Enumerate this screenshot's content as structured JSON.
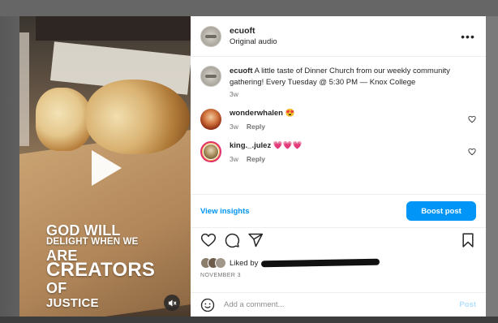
{
  "colors": {
    "accent": "#0095f6",
    "heart_red": "#ed4956",
    "text": "#262626",
    "muted": "#737373"
  },
  "media": {
    "overlay_lines": [
      "GOD WILL",
      "DELIGHT WHEN WE",
      "ARE",
      "CREATORS",
      "OF",
      "JUSTICE"
    ],
    "play_icon": "play-icon",
    "mute_icon": "muted-speaker-icon"
  },
  "header": {
    "username": "ecuoft",
    "subtitle": "Original audio",
    "more_icon": "more-horizontal-icon",
    "more_label": "•••"
  },
  "caption": {
    "username": "ecuoft",
    "text": "A little taste of Dinner Church from our weekly community gathering! Every Tuesday @ 5:30 PM — Knox College",
    "time": "3w"
  },
  "comments": [
    {
      "username": "wonderwhalen",
      "text": "😍",
      "time": "3w",
      "reply_label": "Reply"
    },
    {
      "username": "king._.julez",
      "text": "💗💗💗",
      "time": "3w",
      "reply_label": "Reply"
    }
  ],
  "insights": {
    "view_label": "View insights",
    "boost_label": "Boost post"
  },
  "actions": [
    "heart-outline-icon",
    "comment-bubble-icon",
    "share-paper-plane-icon",
    "bookmark-icon"
  ],
  "likes": {
    "prefix": "Liked by"
  },
  "date": "NOVEMBER 3",
  "add_comment": {
    "placeholder": "Add a comment...",
    "post_label": "Post",
    "emoji_icon": "emoji-smiley-icon"
  }
}
